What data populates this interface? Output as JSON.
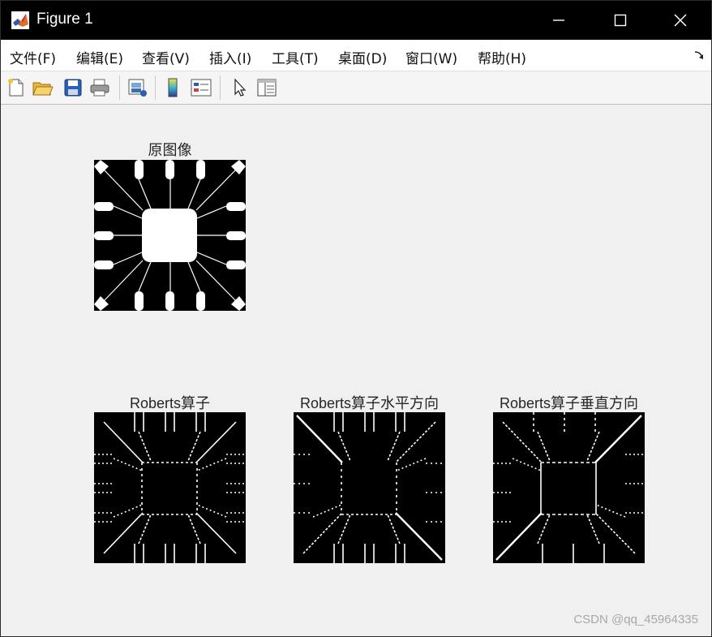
{
  "window": {
    "title": "Figure 1",
    "controls": {
      "minimize": "minimize",
      "maximize": "maximize",
      "close": "close"
    }
  },
  "menu": [
    "文件(F)",
    "编辑(E)",
    "查看(V)",
    "插入(I)",
    "工具(T)",
    "桌面(D)",
    "窗口(W)",
    "帮助(H)"
  ],
  "toolbar": [
    "new-figure-icon",
    "open-file-icon",
    "save-icon",
    "print-icon",
    "link-plot-icon",
    "insert-colorbar-icon",
    "insert-legend-icon",
    "edit-plot-icon",
    "property-inspector-icon"
  ],
  "subplots": [
    {
      "title": "原图像",
      "image": "original"
    },
    {
      "title": "Roberts算子",
      "image": "roberts-both"
    },
    {
      "title": "Roberts算子水平方向",
      "image": "roberts-horizontal"
    },
    {
      "title": "Roberts算子垂直方向",
      "image": "roberts-vertical"
    }
  ],
  "watermark": "CSDN @qq_45964335",
  "colors": {
    "titlebar": "#000000",
    "figure_bg": "#f0f0f0",
    "image_bg": "#000000",
    "image_fg": "#ffffff"
  }
}
